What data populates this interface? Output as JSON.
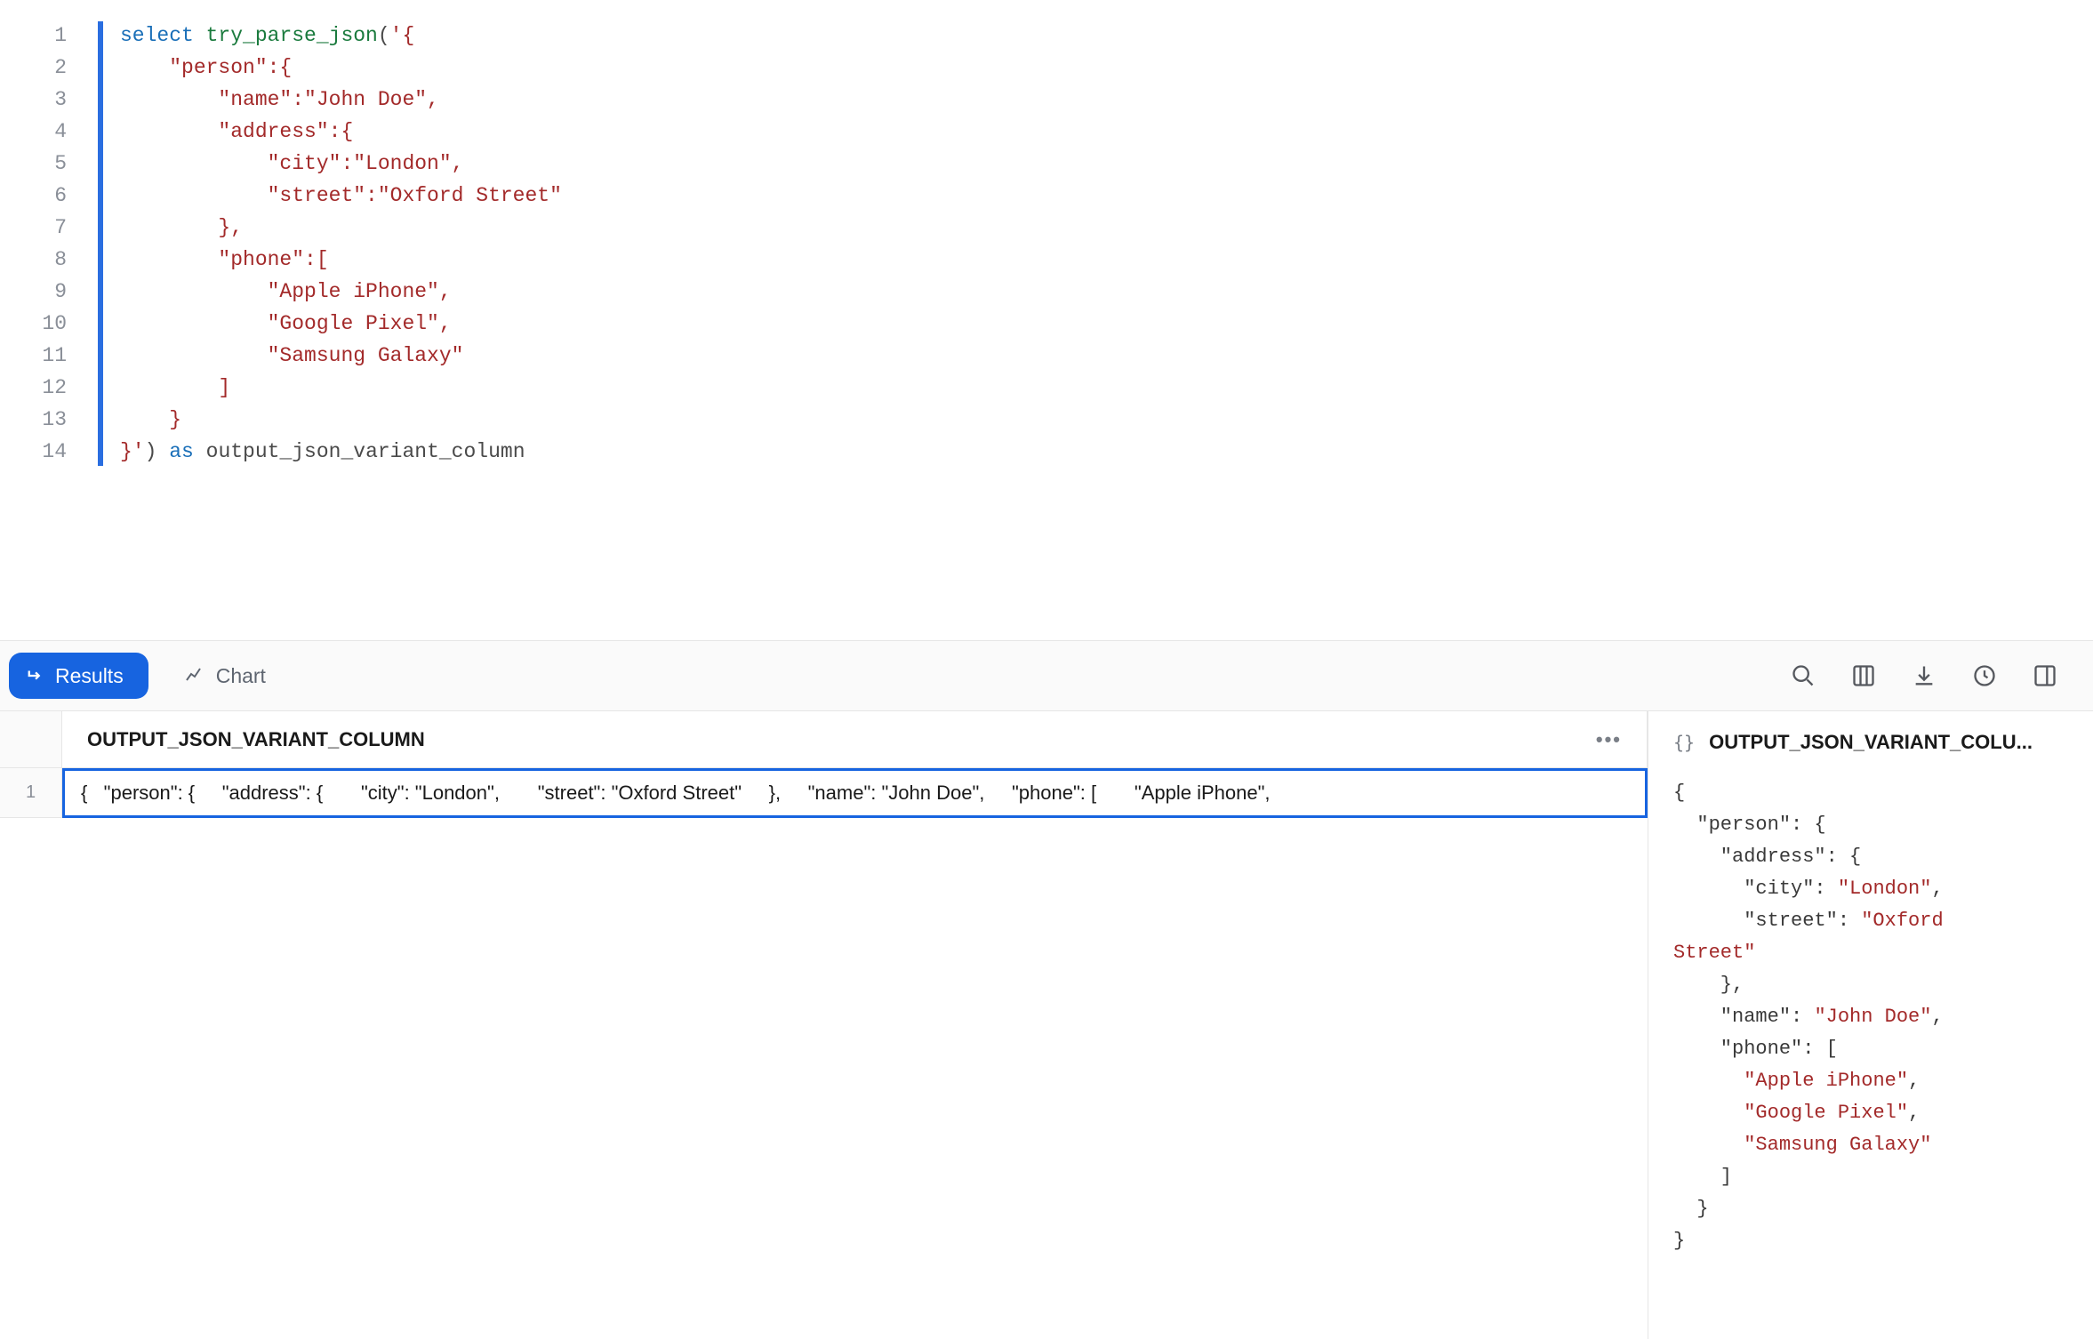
{
  "editor": {
    "line_count": 14,
    "tokens": [
      [
        [
          "select ",
          "kw"
        ],
        [
          "try_parse_json",
          "fn"
        ],
        [
          "(",
          "pl"
        ],
        [
          "'{",
          "str"
        ]
      ],
      [
        [
          "    \"person\":{",
          "str"
        ]
      ],
      [
        [
          "        \"name\":\"John Doe\",",
          "str"
        ]
      ],
      [
        [
          "        \"address\":{",
          "str"
        ]
      ],
      [
        [
          "            \"city\":\"London\",",
          "str"
        ]
      ],
      [
        [
          "            \"street\":\"Oxford Street\"",
          "str"
        ]
      ],
      [
        [
          "        },",
          "str"
        ]
      ],
      [
        [
          "        \"phone\":[",
          "str"
        ]
      ],
      [
        [
          "            \"Apple iPhone\",",
          "str"
        ]
      ],
      [
        [
          "            \"Google Pixel\",",
          "str"
        ]
      ],
      [
        [
          "            \"Samsung Galaxy\"",
          "str"
        ]
      ],
      [
        [
          "        ]",
          "str"
        ]
      ],
      [
        [
          "    }",
          "str"
        ]
      ],
      [
        [
          "}'",
          "str"
        ],
        [
          ") ",
          "pl"
        ],
        [
          "as ",
          "kw"
        ],
        [
          "output_json_variant_column",
          "pl"
        ]
      ]
    ]
  },
  "toolbar": {
    "results_label": "Results",
    "chart_label": "Chart"
  },
  "grid": {
    "column_header": "OUTPUT_JSON_VARIANT_COLUMN",
    "row_number": "1",
    "cell_value": "{   \"person\": {     \"address\": {       \"city\": \"London\",       \"street\": \"Oxford Street\"     },     \"name\": \"John Doe\",     \"phone\": [       \"Apple iPhone\","
  },
  "detail": {
    "type_badge": "{}",
    "title": "OUTPUT_JSON_VARIANT_COLU...",
    "lines": [
      [
        [
          "{",
          "pn"
        ]
      ],
      [
        [
          "  \"person\": {",
          "pn"
        ]
      ],
      [
        [
          "    \"address\": {",
          "pn"
        ]
      ],
      [
        [
          "      \"city\": ",
          "pn"
        ],
        [
          "\"London\"",
          "sv"
        ],
        [
          ",",
          "pn"
        ]
      ],
      [
        [
          "      \"street\": ",
          "pn"
        ],
        [
          "\"Oxford ",
          "sv"
        ]
      ],
      [
        [
          "Street\"",
          "sv"
        ]
      ],
      [
        [
          "    },",
          "pn"
        ]
      ],
      [
        [
          "    \"name\": ",
          "pn"
        ],
        [
          "\"John Doe\"",
          "sv"
        ],
        [
          ",",
          "pn"
        ]
      ],
      [
        [
          "    \"phone\": [",
          "pn"
        ]
      ],
      [
        [
          "      ",
          "pn"
        ],
        [
          "\"Apple iPhone\"",
          "sv"
        ],
        [
          ",",
          "pn"
        ]
      ],
      [
        [
          "      ",
          "pn"
        ],
        [
          "\"Google Pixel\"",
          "sv"
        ],
        [
          ",",
          "pn"
        ]
      ],
      [
        [
          "      ",
          "pn"
        ],
        [
          "\"Samsung Galaxy\"",
          "sv"
        ]
      ],
      [
        [
          "    ]",
          "pn"
        ]
      ],
      [
        [
          "  }",
          "pn"
        ]
      ],
      [
        [
          "}",
          "pn"
        ]
      ]
    ]
  }
}
